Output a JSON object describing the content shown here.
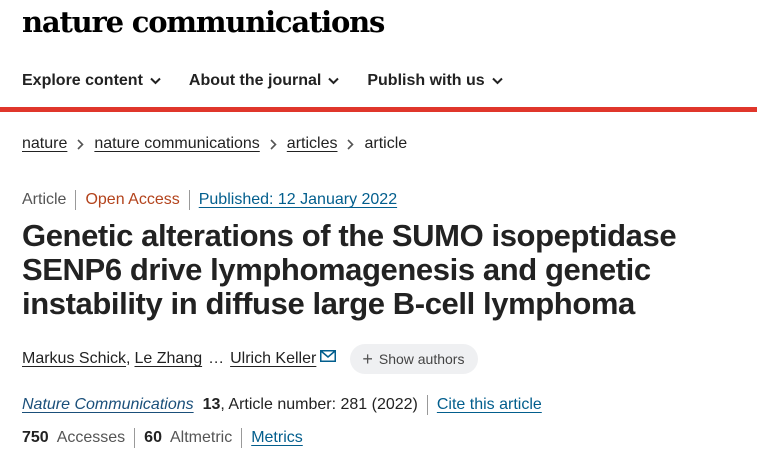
{
  "header": {
    "brand": "nature communications"
  },
  "nav": {
    "items": [
      {
        "label": "Explore content"
      },
      {
        "label": "About the journal"
      },
      {
        "label": "Publish with us"
      }
    ]
  },
  "breadcrumb": {
    "items": [
      "nature",
      "nature communications",
      "articles"
    ],
    "current": "article"
  },
  "article": {
    "type": "Article",
    "access": "Open Access",
    "published": "Published: 12 January 2022",
    "title": "Genetic alterations of the SUMO isopeptidase SENP6 drive lymphomagenesis and genetic instability in diffuse large B-cell lymphoma",
    "authors": [
      "Markus Schick",
      "Le Zhang",
      "Ulrich Keller"
    ],
    "author_separator": ",",
    "ellipsis": "…",
    "show_authors": "Show authors",
    "journal": "Nature Communications",
    "volume": "13",
    "article_number": ", Article number: 281 (2022)",
    "cite_label": "Cite this article",
    "accesses_value": "750",
    "accesses_label": "Accesses",
    "altmetric_value": "60",
    "altmetric_label": "Altmetric",
    "metrics_label": "Metrics"
  },
  "colors": {
    "accent_rule": "#e0362b",
    "link": "#025e8d",
    "open_access": "#b3431c"
  },
  "icons": [
    "chevron-down-icon",
    "chevron-right-icon",
    "envelope-icon",
    "plus-icon"
  ]
}
